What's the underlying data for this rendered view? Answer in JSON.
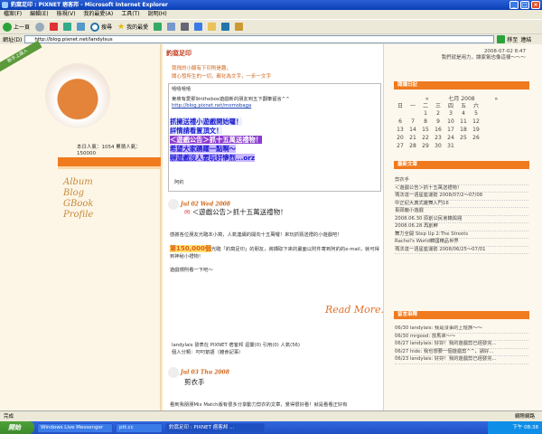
{
  "window": {
    "title": "釣窩足印 : PIXNET 痞客邦 - Microsoft Internet Explorer"
  },
  "menu": [
    "檔案(F)",
    "編輯(E)",
    "檢視(V)",
    "我的最愛(A)",
    "工具(T)",
    "說明(H)"
  ],
  "toolbar": {
    "back": "上一頁",
    "search": "搜尋",
    "favorites": "我的最愛"
  },
  "address": {
    "label": "網址(D)",
    "value": "http://blog.pixnet.net/landylsus",
    "go": "移至",
    "links": "連結"
  },
  "left": {
    "badge": "新手上路入",
    "visits": "本日人氣：1054 累積人氣：150000",
    "nav": [
      "Album",
      "Blog",
      "GBook",
      "Profile"
    ]
  },
  "blog": {
    "title": "釣窩足印",
    "slogan": [
      "我飛的小腳有下印則是趣，",
      "聞心發所生的一切，都化為文字，一步一文字"
    ]
  },
  "notice": {
    "heading": "嘻嘻嘻嘻",
    "line1": "東坡有愛那9inthebox遊戲新的朋友到五下翻筆留言^^",
    "link": "http://blog.pixnet.net/momobaga",
    "promo": [
      "抓擁送禮小遊戲開始囉！",
      "詳情請看置頂文！",
      "＜遊戲公告＞抓十五萬送禮物！",
      "希望大家踴躍一點啊～",
      "辦遊戲沒人要玩好慘烈...orz"
    ],
    "sign": "阿釣"
  },
  "post1": {
    "date": "Jul 02 Wed 2008",
    "title": "＜遊戲公告＞抓十五萬送禮物！",
    "body1": "感謝各位朋友光臨本小窩，人氣連續的開向十五萬囉！來玩抓猜送禮的小遊戲吧！",
    "highlight": "第150,000個",
    "body2": "光臨「釣窩足印」的朋友，將擷取下來的畫面以附件寄到阿釣的e-mail，就可得到神秘小禮物！",
    "body3": "遊戲規則看一下吧～",
    "readmore": "Read More.",
    "meta1": "landylais 發表在 PIXNET 痞客邦 迴響(0) 引用(0) 人氣(56)",
    "meta2": "個人分類：叼叼絮語（雜食記事）"
  },
  "post2": {
    "date": "Jul 03 Thu 2008",
    "title": "剪衣手",
    "body": "看到我朋朋Mix Match版有很多分享動力剪衣的文章，覺得很好看！就是看看正好有"
  },
  "right": {
    "datetime": "2008-07-02 8:47",
    "motto": "我們就是用力，讓家氣也像這樣～～～",
    "cal_title": "閱讀日記",
    "cal_month": "七月 2008",
    "weekdays": [
      "日",
      "一",
      "二",
      "三",
      "四",
      "五",
      "六"
    ],
    "days": [
      [
        "",
        "",
        "1",
        "2",
        "3",
        "4",
        "5"
      ],
      [
        "6",
        "7",
        "8",
        "9",
        "10",
        "11",
        "12"
      ],
      [
        "13",
        "14",
        "15",
        "16",
        "17",
        "18",
        "19"
      ],
      [
        "20",
        "21",
        "22",
        "23",
        "24",
        "25",
        "26"
      ],
      [
        "27",
        "28",
        "29",
        "30",
        "31",
        "",
        ""
      ]
    ],
    "cat_title": "最新文章",
    "articles": [
      "剪衣手",
      "＜遊戲公告＞抓十五萬送禮物！",
      "瑪法達一週星座運勢 2008/07/2～07/08",
      "中正紀大典式雞舞入門16",
      "長頸鹿小遊戲",
      "2008.06.30 原創公民會籍與證",
      "2008.06.28 再創鮮",
      "舞力全開 Step Up 2:The Streets",
      "Rachel's World韓國精品世界",
      "瑪法達一週星座運勢 2008/06/25～07/01"
    ],
    "comments_title": "留言串釋",
    "comments": [
      "06/30 landylais: 我是沒事的上班族～～",
      "06/30 mrgood: 放馬來～～",
      "06/27 landylais: 好好！我的遊戲剪已經發完...",
      "06/27 hide: 我也想要一個遊戲剪^^，請好...",
      "06/23 landylais: 好好！我的遊戲剪已經發完..."
    ]
  },
  "status": {
    "text": "完成",
    "zone": "網際網路"
  },
  "taskbar": {
    "start": "開始",
    "tasks": [
      "Windows Live Messenger",
      "ptt.cc",
      "釣窩足印 : PIXNET 痞客邦 ..."
    ],
    "time": "下午 08:38"
  }
}
